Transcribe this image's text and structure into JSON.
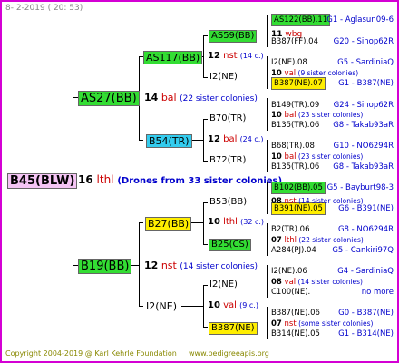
{
  "header": "8-  2-2019 ( 20: 53)",
  "footer": {
    "copyright": "Copyright 2004-2019 @ Karl Kehrle Foundation",
    "site": "www.pedigreeapis.org"
  },
  "root": {
    "label": "B45(BLW)",
    "num": "16",
    "race": "lthl",
    "note": "(Drones from 33 sister colonies)"
  },
  "gen1": {
    "top": {
      "label": "AS27(BB)",
      "num": "14",
      "race": "bal",
      "note": "(22 sister colonies)"
    },
    "bottom": {
      "label": "B19(BB)",
      "num": "12",
      "race": "nst",
      "note": "(14 sister colonies)"
    }
  },
  "gen2": {
    "a": {
      "label": "AS117(BB)",
      "num": "12",
      "race": "nst",
      "note": "(14 c.)"
    },
    "b": {
      "label": "B54(TR)",
      "num": "12",
      "race": "bal",
      "note": "(24 c.)"
    },
    "c": {
      "label": "B27(BB)",
      "num": "10",
      "race": "lthl",
      "note": "(32 c.)"
    },
    "d": {
      "label": "I2(NE)",
      "num": "10",
      "race": "val",
      "note": "(9 c.)"
    }
  },
  "gen3": {
    "a1": {
      "label": "AS59(BB)",
      "num": "11",
      "race": "wbg"
    },
    "a2": {
      "label": "I2(NE)"
    },
    "b1": {
      "label": "B70(TR)"
    },
    "b2": {
      "label": "B72(TR)"
    },
    "c1": {
      "label": "B53(BB)",
      "num": "08",
      "race": "nst",
      "note": "(14 sister colonies)"
    },
    "c2": {
      "label": "B25(CS)"
    },
    "d1": {
      "label": "I2(NE)"
    },
    "d2": {
      "label": "B387(NE)"
    }
  },
  "gen4": [
    {
      "left": "AS122(BB).11",
      "right": "G1 - Aglasun09-6"
    },
    {
      "left": "B387(FF).04",
      "right": "G20 - Sinop62R"
    },
    {
      "left": "I2(NE).08",
      "right": "G5 - SardiniaQ"
    },
    {
      "num": "10",
      "race": "val",
      "note": "(9 sister colonies)"
    },
    {
      "left": "B387(NE).07",
      "right": "G1 - B387(NE)"
    },
    {
      "left": "B149(TR).09",
      "right": "G24 - Sinop62R"
    },
    {
      "num": "10",
      "race": "bal",
      "note": "(23 sister colonies)"
    },
    {
      "left": "B135(TR).06",
      "right": "G8 - Takab93aR"
    },
    {
      "left": "B68(TR).08",
      "right": "G10 - NO6294R"
    },
    {
      "num": "10",
      "race": "bal",
      "note": "(23 sister colonies)"
    },
    {
      "left": "B135(TR).06",
      "right": "G8 - Takab93aR"
    },
    {
      "left": "B102(BB).05",
      "right": "G5 - Bayburt98-3"
    },
    {
      "left": "B391(NE).05",
      "right": "G6 - B391(NE)"
    },
    {
      "left": "B2(TR).06",
      "right": "G8 - NO6294R"
    },
    {
      "num": "07",
      "race": "lthl",
      "note": "(22 sister colonies)"
    },
    {
      "left": "A284(PJ).04",
      "right": "G5 - Cankiri97Q"
    },
    {
      "left": "I2(NE).06",
      "right": "G4 - SardiniaQ"
    },
    {
      "num": "08",
      "race": "val",
      "note": "(14 sister colonies)"
    },
    {
      "left": "C100(NE).",
      "right": "no more"
    },
    {
      "left": "B387(NE).06",
      "right": "G0 - B387(NE)"
    },
    {
      "num": "07",
      "race": "nst",
      "note": "(some sister colonies)"
    },
    {
      "left": "B314(NE).05",
      "right": "G1 - B314(NE)"
    }
  ]
}
